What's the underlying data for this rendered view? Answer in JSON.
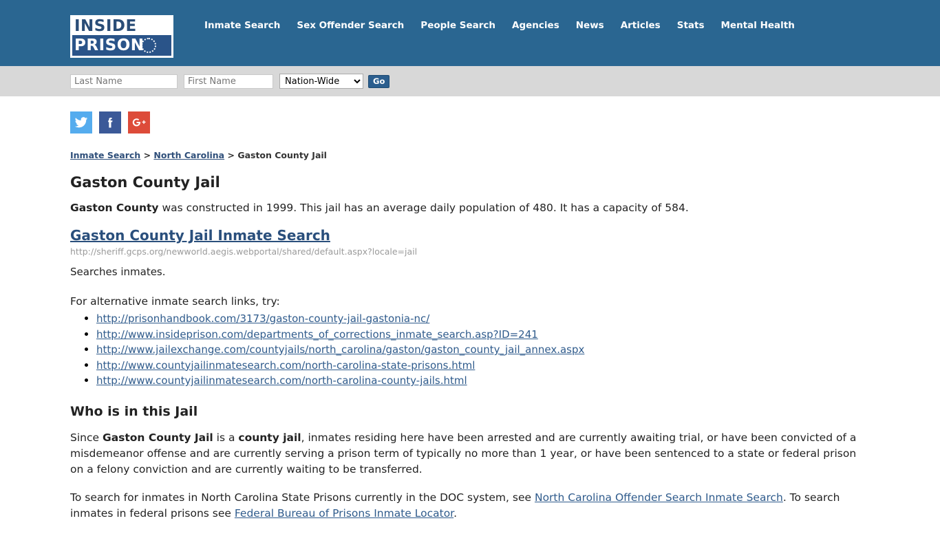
{
  "header": {
    "logo": {
      "line1": "INSIDE",
      "line2": "PRISON"
    },
    "nav": [
      {
        "label": "Inmate Search",
        "name": "nav-inmate-search"
      },
      {
        "label": "Sex Offender Search",
        "name": "nav-sex-offender-search"
      },
      {
        "label": "People Search",
        "name": "nav-people-search"
      },
      {
        "label": "Agencies",
        "name": "nav-agencies"
      },
      {
        "label": "News",
        "name": "nav-news"
      },
      {
        "label": "Articles",
        "name": "nav-articles"
      },
      {
        "label": "Stats",
        "name": "nav-stats"
      },
      {
        "label": "Mental Health",
        "name": "nav-mental-health"
      }
    ],
    "background_color": "#2a6691"
  },
  "search_bar": {
    "last_name_placeholder": "Last Name",
    "last_name_value": "",
    "first_name_placeholder": "First Name",
    "first_name_value": "",
    "region_selected": "Nation-Wide",
    "region_options": [
      "Nation-Wide"
    ],
    "go_label": "Go",
    "background_color": "#d8d8d8"
  },
  "social": [
    {
      "name": "twitter-icon",
      "label": "Twitter",
      "color": "#55acee"
    },
    {
      "name": "facebook-icon",
      "label": "Facebook",
      "color": "#3b5998"
    },
    {
      "name": "google-plus-icon",
      "label": "Google Plus",
      "color": "#dd4b39"
    }
  ],
  "breadcrumb": {
    "item1": "Inmate Search",
    "sep1": " > ",
    "item2": "North Carolina",
    "sep2": " > ",
    "current": "Gaston County Jail"
  },
  "main": {
    "page_title": "Gaston County Jail",
    "intro": {
      "bold_lead": "Gaston County",
      "rest": " was constructed in 1999. This jail has an average daily population of 480. It has a capacity of 584."
    },
    "inmate_search_link_label": "Gaston County Jail Inmate Search",
    "inmate_search_url": "http://sheriff.gcps.org/newworld.aegis.webportal/shared/default.aspx?locale=jail",
    "search_description": "Searches inmates.",
    "alternatives_intro": "For alternative inmate search links, try:",
    "alternative_links": [
      "http://prisonhandbook.com/3173/gaston-county-jail-gastonia-nc/",
      "http://www.insideprison.com/departments_of_corrections_inmate_search.asp?ID=241",
      "http://www.jailexchange.com/countyjails/north_carolina/gaston/gaston_county_jail_annex.aspx",
      "http://www.countyjailinmatesearch.com/north-carolina-state-prisons.html",
      "http://www.countyjailinmatesearch.com/north-carolina-county-jails.html"
    ],
    "who_heading": "Who is in this Jail",
    "who_paragraph": {
      "p1": "Since ",
      "b1": "Gaston County Jail",
      "p2": " is a ",
      "b2": "county jail",
      "p3": ", inmates residing here have been arrested and are currently awaiting trial, or have been convicted of a misdemeanor offense and are currently serving a prison term of typically no more than 1 year, or have been sentenced to a state or federal prison on a felony conviction and are currently waiting to be transferred."
    },
    "doc_paragraph": {
      "p1": "To search for inmates in North Carolina State Prisons currently in the DOC system, see ",
      "link1": "North Carolina Offender Search Inmate Search",
      "p2": ". To search inmates in federal prisons see ",
      "link2": "Federal Bureau of Prisons Inmate Locator",
      "p3": "."
    }
  }
}
